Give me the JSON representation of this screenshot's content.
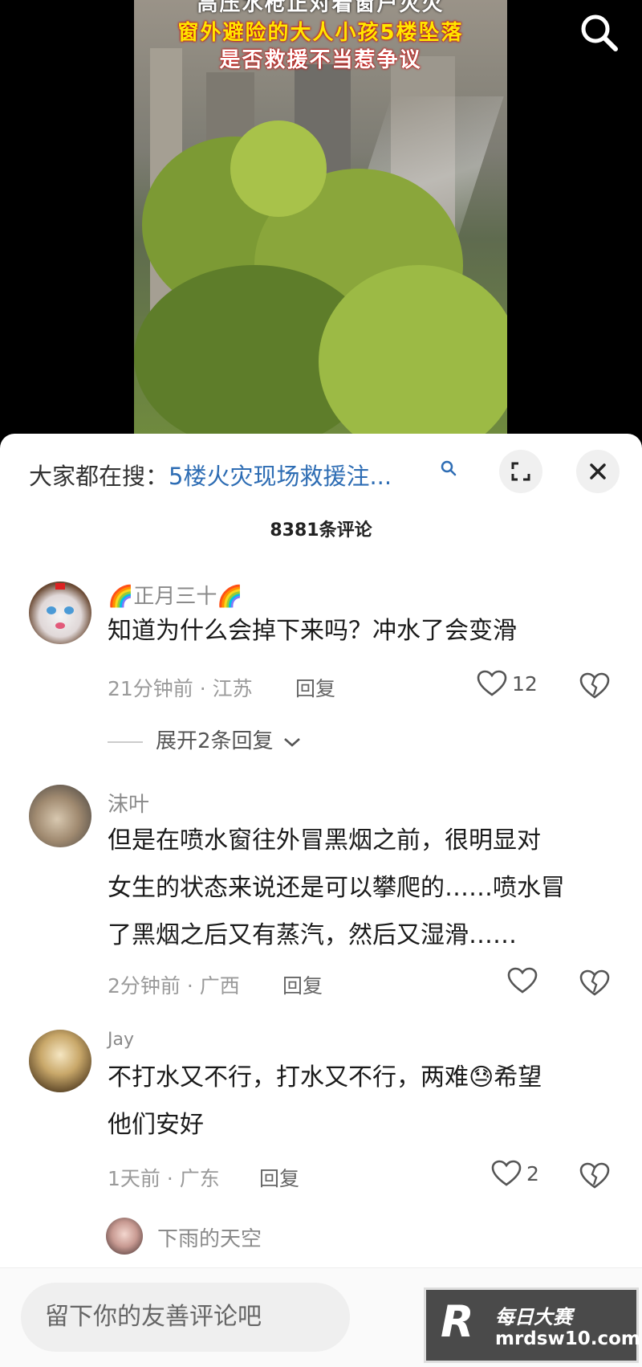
{
  "video": {
    "caption_line1": "高压水枪正对着窗户灭火",
    "caption_line2": "窗外避险的大人小孩5楼坠落",
    "caption_line3": "是否救援不当惹争议"
  },
  "header": {
    "trending_label": "大家都在搜：",
    "trending_query": "5楼火灾现场救援注...",
    "comment_count": "8381条评论"
  },
  "comments": [
    {
      "user": "🌈正月三十🌈",
      "text": [
        "知道为什么会掉下来吗？冲水了会变滑"
      ],
      "meta": "21分钟前 · 江苏",
      "reply": "回复",
      "likes": "12",
      "expand": "展开2条回复"
    },
    {
      "user": "沫叶",
      "text": [
        "但是在喷水窗往外冒黑烟之前，很明显对",
        "女生的状态来说还是可以攀爬的……喷水冒",
        "了黑烟之后又有蒸汽，然后又湿滑……"
      ],
      "meta": "2分钟前 · 广西",
      "reply": "回复",
      "likes": ""
    },
    {
      "user": "Jay",
      "text": [
        "不打水又不行，打水又不行，两难😓希望",
        "他们安好"
      ],
      "meta": "1天前 · 广东",
      "reply": "回复",
      "likes": "2"
    },
    {
      "user": "下雨的天空"
    }
  ],
  "input": {
    "placeholder": "留下你的友善评论吧"
  },
  "watermark": {
    "mark": "R",
    "name": "每日大赛",
    "site": "mrdsw10.com"
  },
  "colors": {
    "accent": "#2e6db4",
    "caption_yellow": "#ffe600",
    "caption_red": "#cc0000"
  }
}
